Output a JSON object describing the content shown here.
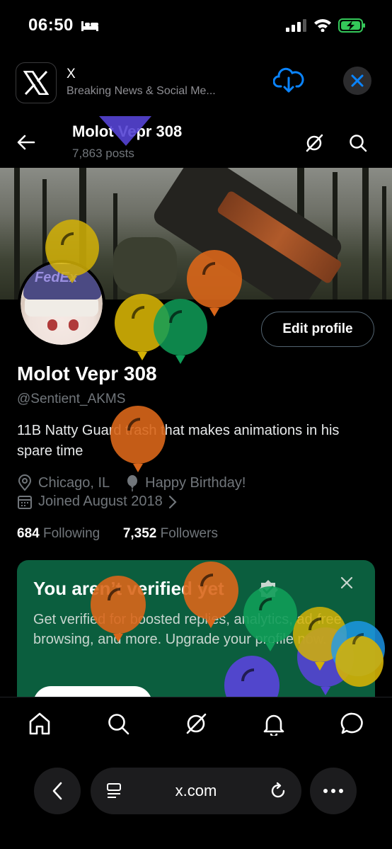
{
  "status_bar": {
    "time": "06:50"
  },
  "app_banner": {
    "app_name": "X",
    "app_description": "Breaking News & Social Me..."
  },
  "profile_nav": {
    "name": "Molot Vepr 308",
    "posts": "7,863 posts"
  },
  "profile": {
    "edit_button": "Edit profile",
    "display_name": "Molot Vepr 308",
    "handle": "@Sentient_AKMS",
    "bio": "11B Natty Guard trash that makes animations in his spare time",
    "location": "Chicago, IL",
    "birthday": "Happy Birthday!",
    "joined": "Joined August 2018",
    "following_count": "684",
    "following_label": "Following",
    "followers_count": "7,352",
    "followers_label": "Followers"
  },
  "verify_card": {
    "title": "You aren’t verified yet",
    "body": "Get verified for boosted replies, analytics, ad-free browsing, and more. Upgrade your profile now."
  },
  "tabbar": {
    "items": [
      "home",
      "search",
      "grok",
      "notifications",
      "messages"
    ]
  },
  "safari": {
    "url": "x.com"
  },
  "colors": {
    "background": "#000000",
    "accent_blue": "#1d9bf0",
    "card_green": "#0b5e3e",
    "balloon_yellow": "#d4b106",
    "balloon_orange": "#d9661a",
    "balloon_green": "#0f9d58",
    "balloon_purple": "#5544d4"
  }
}
